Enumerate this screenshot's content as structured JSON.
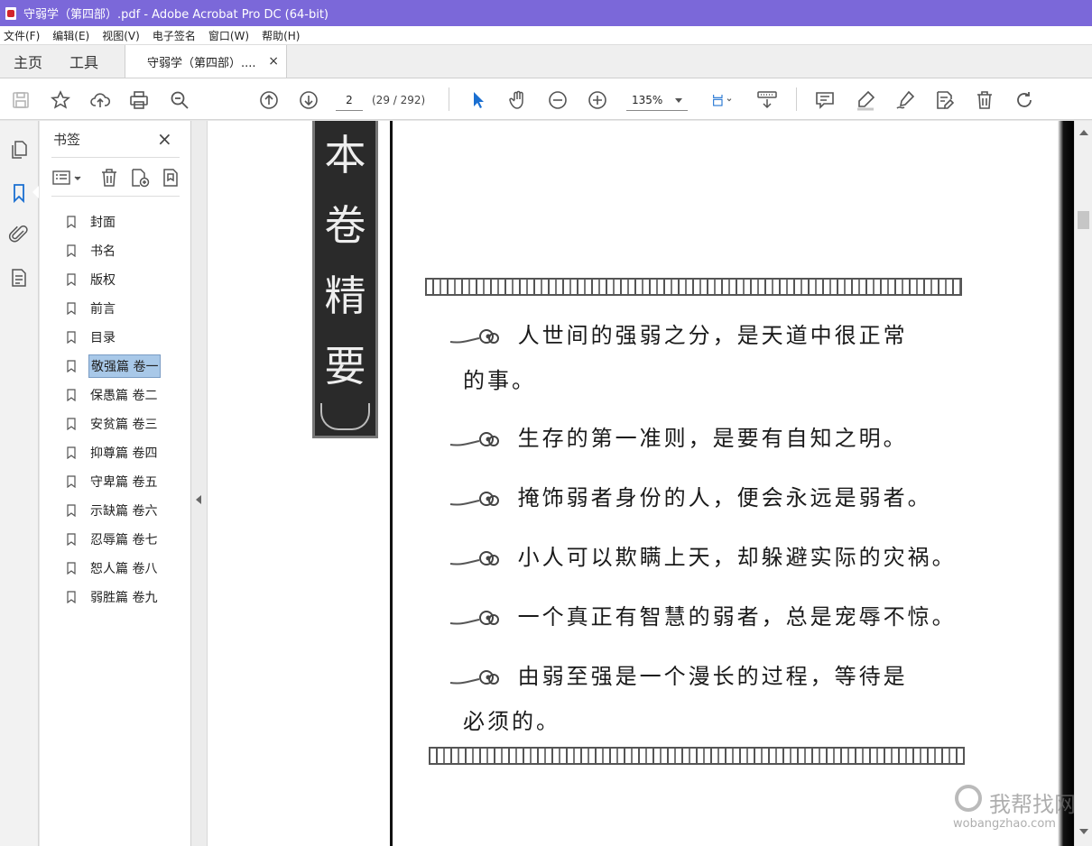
{
  "window": {
    "title": "守弱学（第四部）.pdf - Adobe Acrobat Pro DC (64-bit)"
  },
  "menu": [
    "文件(F)",
    "编辑(E)",
    "视图(V)",
    "电子签名",
    "窗口(W)",
    "帮助(H)"
  ],
  "tabs": {
    "home": "主页",
    "tools": "工具",
    "document": "守弱学（第四部）....",
    "close": "×"
  },
  "toolbar": {
    "page_value": "2",
    "page_count": "(29 / 292)",
    "zoom_value": "135%"
  },
  "bookmarks": {
    "title": "书签",
    "close": "×",
    "items": [
      {
        "label": "封面"
      },
      {
        "label": "书名"
      },
      {
        "label": "版权"
      },
      {
        "label": "前言"
      },
      {
        "label": "目录"
      },
      {
        "label": "敬强篇  卷一",
        "selected": true
      },
      {
        "label": "保愚篇  卷二"
      },
      {
        "label": "安贫篇  卷三"
      },
      {
        "label": "抑尊篇  卷四"
      },
      {
        "label": "守卑篇  卷五"
      },
      {
        "label": "示缺篇  卷六"
      },
      {
        "label": "忍辱篇  卷七"
      },
      {
        "label": "恕人篇  卷八"
      },
      {
        "label": "弱胜篇  卷九"
      }
    ]
  },
  "document": {
    "banner_chars": [
      "本",
      "卷",
      "精",
      "要"
    ],
    "quotes": [
      {
        "line1": "人世间的强弱之分，是天道中很正常",
        "line2": "的事。"
      },
      {
        "line1": "生存的第一准则，是要有自知之明。"
      },
      {
        "line1": "掩饰弱者身份的人，便会永远是弱者。"
      },
      {
        "line1": "小人可以欺瞒上天，却躲避实际的灾祸。"
      },
      {
        "line1": "一个真正有智慧的弱者，总是宠辱不惊。"
      },
      {
        "line1": "由弱至强是一个漫长的过程，等待是",
        "line2": "必须的。"
      }
    ]
  },
  "watermark": {
    "cn": "我帮找网",
    "en": "wobangzhao.com"
  },
  "colors": {
    "titlebar": "#7b68d9",
    "selection": "#a8c8e8",
    "accent_blue": "#1a6fd1"
  }
}
